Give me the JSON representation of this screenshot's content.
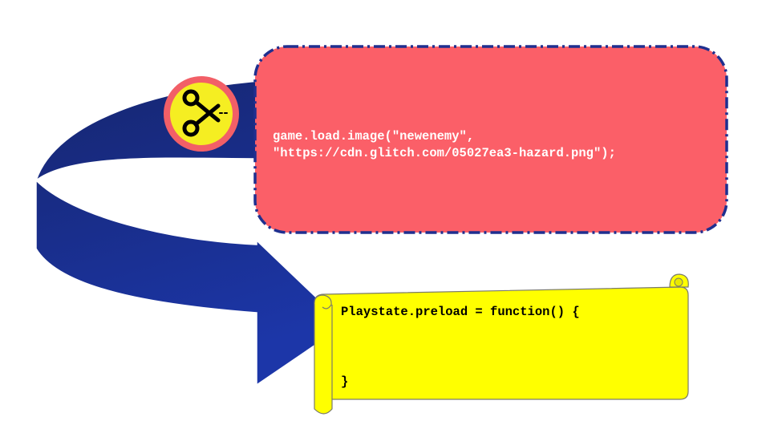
{
  "colors": {
    "background": "#ffffff",
    "arrow_dark": "#1a2a7a",
    "arrow_light": "#1c36a6",
    "code_box_fill": "#fb5f68",
    "code_box_border": "#1f2f8f",
    "code_box_text": "#ffffff",
    "badge_fill": "#f5ee22",
    "badge_ring": "#f25f67",
    "scroll_fill": "#ffff00",
    "scroll_border": "#7a7a6a",
    "scroll_text": "#000000"
  },
  "icons": {
    "cut_badge": "scissors-icon"
  },
  "code_box": {
    "line_1": "game.load.image(\"newenemy\",",
    "line_2": "\"https://cdn.glitch.com/05027ea3-hazard.png\");"
  },
  "scroll": {
    "line_1": "Playstate.preload = function() {",
    "line_2": "}"
  }
}
